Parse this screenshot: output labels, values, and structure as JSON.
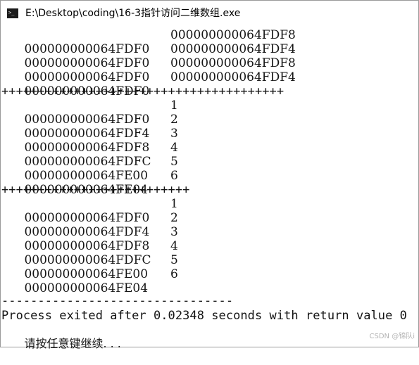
{
  "window": {
    "title": "E:\\Desktop\\coding\\16-3指针访问二维数组.exe",
    "icon": "console-app-icon"
  },
  "console": {
    "block1": [
      {
        "left": "000000000064FDF0",
        "right": "000000000064FDF8"
      },
      {
        "left": "000000000064FDF0",
        "right": "000000000064FDF4"
      },
      {
        "left": "000000000064FDF0",
        "right": "000000000064FDF8"
      },
      {
        "left": "000000000064FDF0",
        "right": "000000000064FDF4"
      }
    ],
    "separator1": "+++++++++++++++++++++++++++++++++++++++",
    "block2": [
      {
        "addr": "000000000064FDF0",
        "value": "1"
      },
      {
        "addr": "000000000064FDF4",
        "value": "2"
      },
      {
        "addr": "000000000064FDF8",
        "value": "3"
      },
      {
        "addr": "000000000064FDFC",
        "value": "4"
      },
      {
        "addr": "000000000064FE00",
        "value": "5"
      },
      {
        "addr": "000000000064FE04",
        "value": "6"
      }
    ],
    "separator2": "++++++++++++++++++++++++++",
    "block3": [
      {
        "addr": "000000000064FDF0",
        "value": "1"
      },
      {
        "addr": "000000000064FDF4",
        "value": "2"
      },
      {
        "addr": "000000000064FDF8",
        "value": "3"
      },
      {
        "addr": "000000000064FDFC",
        "value": "4"
      },
      {
        "addr": "000000000064FE00",
        "value": "5"
      },
      {
        "addr": "000000000064FE04",
        "value": "6"
      }
    ],
    "dash_line": "--------------------------------",
    "exit_message": "Process exited after 0.02348 seconds with return value 0",
    "pause_prompt": "请按任意键继续. . ."
  },
  "watermark": "CSDN @锦队i"
}
